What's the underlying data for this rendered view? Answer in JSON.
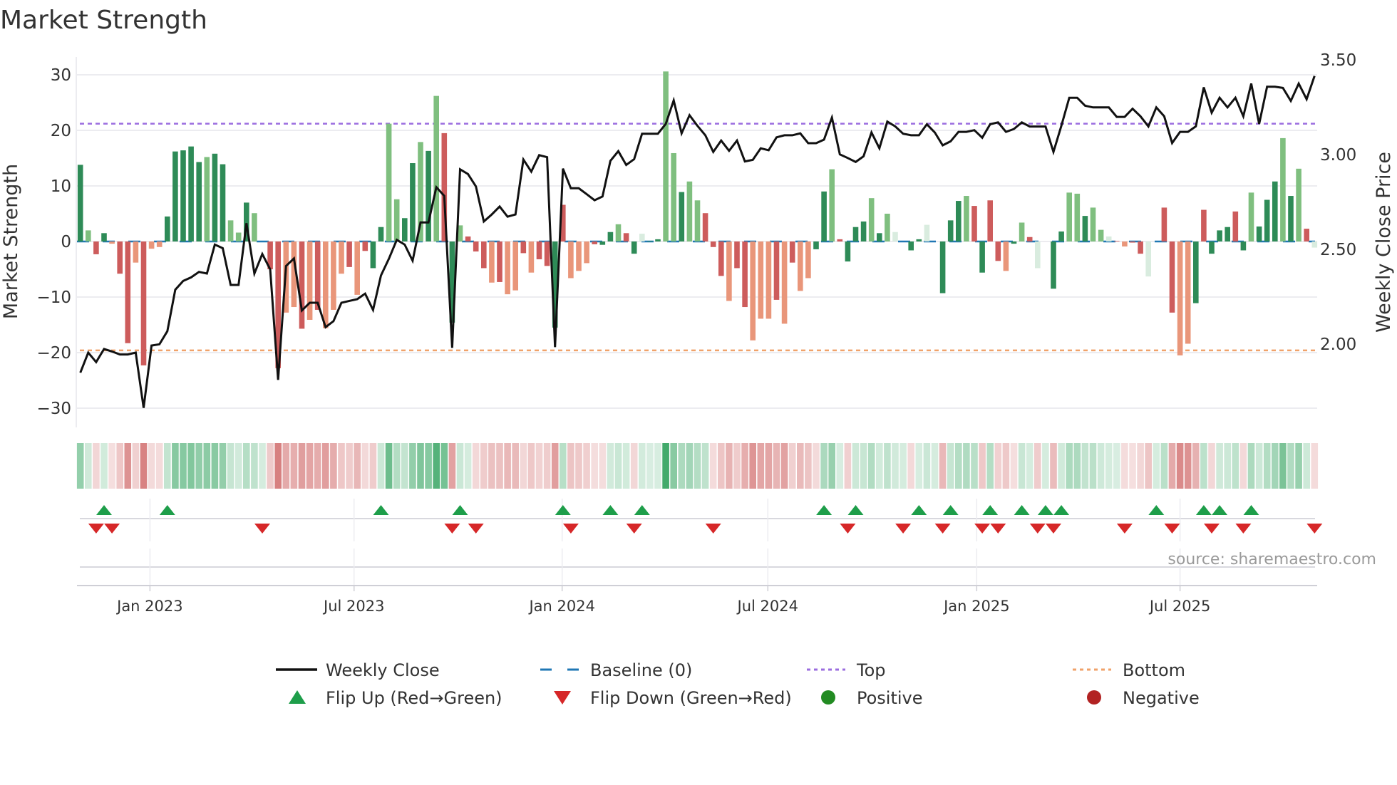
{
  "chart_data": {
    "type": "bar",
    "title": "Market Strength",
    "ylabel": "Market Strength",
    "y2label": "Weekly Close Price",
    "ylim": [
      -33,
      32
    ],
    "y2lim": [
      1.5,
      3.55
    ],
    "yticks": [
      30,
      20,
      10,
      0,
      -10,
      -20,
      -30
    ],
    "ytick_labels": [
      "30",
      "20",
      "10",
      "0",
      "−10",
      "−20",
      "−30"
    ],
    "y2ticks": [
      3.5,
      3.0,
      2.5,
      2.0
    ],
    "y2tick_labels": [
      "3.50",
      "3.00",
      "2.50",
      "2.00"
    ],
    "xticks": [
      {
        "week": 8.8,
        "label": "Jan 2023"
      },
      {
        "week": 34.6,
        "label": "Jul 2023"
      },
      {
        "week": 60.9,
        "label": "Jan 2024"
      },
      {
        "week": 86.9,
        "label": "Jul 2024"
      },
      {
        "week": 113.3,
        "label": "Jan 2025"
      },
      {
        "week": 139.0,
        "label": "Jul 2025"
      }
    ],
    "grid": true,
    "top_threshold": 21.2,
    "bottom_threshold": -19.6,
    "baseline": 0,
    "strength": [
      13.8,
      2.0,
      -2.3,
      1.5,
      -0.4,
      -5.8,
      -18.3,
      -3.8,
      -22.3,
      -1.3,
      -1.0,
      4.5,
      16.2,
      16.4,
      17.1,
      14.3,
      15.2,
      15.8,
      13.9,
      3.8,
      1.6,
      7.0,
      5.1,
      0,
      -5.0,
      -22.8,
      -12.8,
      -11.8,
      -15.7,
      -14.1,
      -12.3,
      -15.6,
      -12.3,
      -5.8,
      -4.6,
      -9.6,
      -1.7,
      -4.8,
      2.6,
      21.2,
      7.6,
      4.2,
      14.1,
      17.9,
      16.3,
      26.2,
      19.5,
      -14.6,
      2.9,
      0.9,
      -1.8,
      -4.8,
      -7.4,
      -7.3,
      -9.5,
      -8.8,
      -2.1,
      -5.6,
      -3.2,
      -4.4,
      -15.5,
      6.6,
      -6.6,
      -5.3,
      -3.9,
      -0.5,
      -0.6,
      1.7,
      3.1,
      1.5,
      -2.2,
      1.4,
      0.1,
      0.4,
      30.6,
      15.9,
      8.9,
      10.8,
      7.4,
      5.1,
      -1.0,
      -6.2,
      -10.7,
      -4.8,
      -11.8,
      -17.8,
      -13.9,
      -13.9,
      -10.5,
      -14.8,
      -3.8,
      -8.9,
      -6.6,
      -1.4,
      9.0,
      13.0,
      0.4,
      -3.6,
      2.6,
      3.6,
      7.8,
      1.5,
      5.0,
      1.7,
      0,
      -1.6,
      0.4,
      3.0,
      0,
      -9.3,
      3.8,
      7.3,
      8.2,
      6.4,
      -5.6,
      7.4,
      -3.5,
      -5.3,
      -0.4,
      3.4,
      0.8,
      -4.8,
      0,
      -8.5,
      1.8,
      8.8,
      8.6,
      4.6,
      6.1,
      2.1,
      0.9,
      0.1,
      -0.9,
      -0.2,
      -2.2,
      -6.3,
      0,
      6.1,
      -12.8,
      -20.5,
      -18.4,
      -11.1,
      5.7,
      -2.2,
      2.0,
      2.6,
      5.4,
      -1.6,
      8.8,
      2.7,
      7.5,
      10.8,
      18.6,
      8.2,
      13.1,
      2.3,
      -1.1
    ],
    "shade_codes": "glrgorrorooggggglggllglzrroororooororggllgglglrglrrroroororrgrooorgglrgzggllgllrrrorrooororoogglrggglglzrggzrggglrgrroglrzrggllgllzrorrzgrroogrgggrglggglglr",
    "shade_legend": {
      "g": "strong positive",
      "l": "weak positive",
      "r": "strong negative",
      "o": "weak negative",
      "z": "neutral"
    },
    "weekly_close": [
      1.849,
      1.955,
      1.905,
      1.974,
      1.961,
      1.945,
      1.945,
      1.955,
      1.663,
      1.992,
      1.999,
      2.068,
      2.287,
      2.333,
      2.352,
      2.381,
      2.372,
      2.525,
      2.506,
      2.312,
      2.312,
      2.638,
      2.372,
      2.475,
      2.394,
      1.811,
      2.412,
      2.452,
      2.177,
      2.218,
      2.218,
      2.089,
      2.121,
      2.218,
      2.228,
      2.237,
      2.266,
      2.18,
      2.362,
      2.45,
      2.55,
      2.525,
      2.44,
      2.642,
      2.642,
      2.828,
      2.782,
      1.98,
      2.922,
      2.897,
      2.832,
      2.647,
      2.684,
      2.726,
      2.672,
      2.684,
      2.974,
      2.91,
      2.997,
      2.986,
      1.984,
      2.926,
      2.822,
      2.822,
      2.791,
      2.759,
      2.779,
      2.967,
      3.018,
      2.945,
      2.976,
      3.11,
      3.11,
      3.11,
      3.162,
      3.286,
      3.112,
      3.208,
      3.152,
      3.102,
      3.014,
      3.074,
      3.02,
      3.074,
      2.964,
      2.972,
      3.033,
      3.023,
      3.091,
      3.102,
      3.102,
      3.112,
      3.06,
      3.06,
      3.079,
      3.195,
      3.001,
      2.982,
      2.961,
      2.991,
      3.117,
      3.033,
      3.174,
      3.149,
      3.11,
      3.102,
      3.102,
      3.16,
      3.117,
      3.049,
      3.07,
      3.12,
      3.12,
      3.129,
      3.089,
      3.16,
      3.17,
      3.12,
      3.135,
      3.17,
      3.148,
      3.148,
      3.148,
      3.014,
      3.152,
      3.3,
      3.3,
      3.258,
      3.249,
      3.249,
      3.249,
      3.199,
      3.199,
      3.242,
      3.202,
      3.148,
      3.249,
      3.202,
      3.061,
      3.12,
      3.12,
      3.149,
      3.355,
      3.221,
      3.3,
      3.249,
      3.3,
      3.202,
      3.375,
      3.162,
      3.358,
      3.358,
      3.352,
      3.283,
      3.375,
      3.292,
      3.415
    ],
    "flip_up_weeks": [
      3,
      11,
      38,
      48,
      61,
      67,
      71,
      94,
      98,
      106,
      110,
      115,
      119,
      122,
      124,
      136,
      142,
      144,
      148
    ],
    "flip_down_weeks": [
      2,
      4,
      23,
      47,
      50,
      62,
      70,
      80,
      97,
      104,
      109,
      114,
      116,
      121,
      123,
      132,
      138,
      143,
      147,
      156
    ],
    "legend": [
      {
        "label": "Weekly Close",
        "kind": "line",
        "color": "#111111"
      },
      {
        "label": "Baseline (0)",
        "kind": "dash",
        "color": "#1f77b4"
      },
      {
        "label": "Top",
        "kind": "dot",
        "color": "#9b6ddf"
      },
      {
        "label": "Bottom",
        "kind": "dot",
        "color": "#f0a26a"
      },
      {
        "label": "Flip Up (Red→Green)",
        "kind": "up",
        "color": "#1e9e4a"
      },
      {
        "label": "Flip Down (Green→Red)",
        "kind": "down",
        "color": "#d62728"
      },
      {
        "label": "Positive",
        "kind": "circle",
        "color": "#228b22"
      },
      {
        "label": "Negative",
        "kind": "circle",
        "color": "#b22222"
      }
    ],
    "legend_placement": "bottom",
    "source": "source: sharemaestro.com"
  },
  "colors": {
    "strong_pos": "#2e8b57",
    "weak_pos": "#7fbf7f",
    "strong_neg": "#cd5c5c",
    "weak_neg": "#e9967a",
    "neutral": "#d9ecdf",
    "grid": "#ececf0",
    "top": "#9b6ddf",
    "bottom": "#f0a26a",
    "baseline": "#1f77b4"
  }
}
